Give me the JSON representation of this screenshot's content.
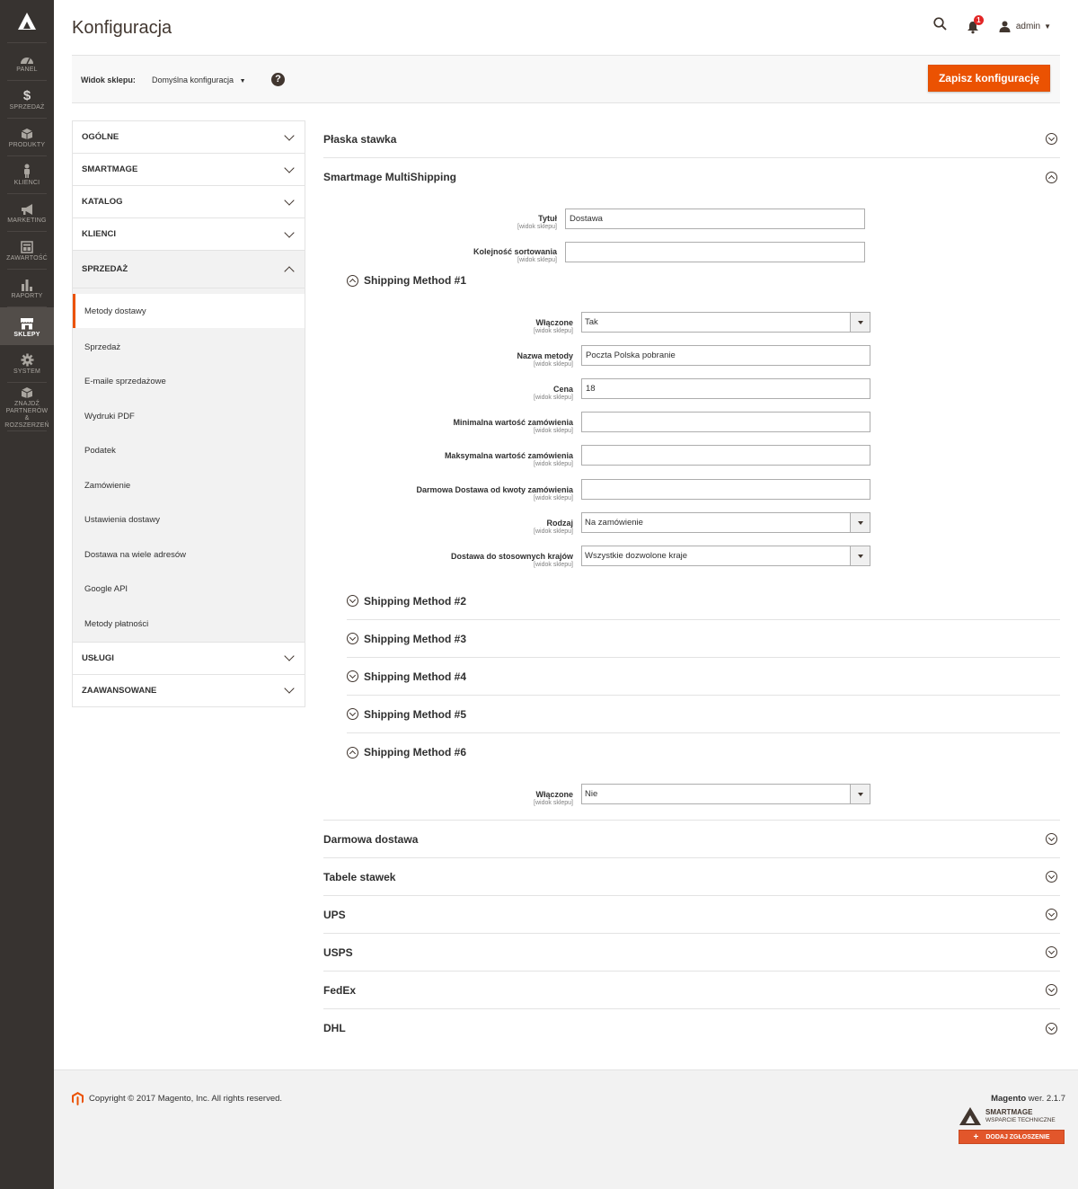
{
  "sidebar": {
    "items": [
      {
        "label": "PANEL",
        "icon": "dashboard-icon"
      },
      {
        "label": "SPRZEDAŻ",
        "icon": "dollar-icon"
      },
      {
        "label": "PRODUKTY",
        "icon": "box-icon"
      },
      {
        "label": "KLIENCI",
        "icon": "person-icon"
      },
      {
        "label": "MARKETING",
        "icon": "megaphone-icon"
      },
      {
        "label": "ZAWARTOŚĆ",
        "icon": "layout-icon"
      },
      {
        "label": "RAPORTY",
        "icon": "bar-chart-icon"
      },
      {
        "label": "SKLEPY",
        "icon": "store-icon"
      },
      {
        "label": "SYSTEM",
        "icon": "gear-icon"
      },
      {
        "label": "ZNAJDŹ PARTNERÓW & ROZSZERZEŃ",
        "icon": "extensions-icon"
      }
    ],
    "active": "SKLEPY"
  },
  "header": {
    "title": "Konfiguracja",
    "notifications_count": "1",
    "user": "admin"
  },
  "store_bar": {
    "label": "Widok sklepu:",
    "value": "Domyślna konfiguracja",
    "help": "?"
  },
  "save_button": "Zapisz konfigurację",
  "config_nav": {
    "groups_top": [
      "OGÓLNE",
      "SMARTMAGE",
      "KATALOG",
      "KLIENCI"
    ],
    "open_group": "SPRZEDAŻ",
    "sub_items": [
      "Metody dostawy",
      "Sprzedaż",
      "E-maile sprzedażowe",
      "Wydruki PDF",
      "Podatek",
      "Zamówienie",
      "Ustawienia dostawy",
      "Dostawa na wiele adresów",
      "Google API",
      "Metody płatności"
    ],
    "groups_bottom": [
      "USŁUGI",
      "ZAAWANSOWANE"
    ]
  },
  "sections": {
    "flat_rate": "Płaska stawka",
    "multishipping": "Smartmage MultiShipping",
    "free_shipping": "Darmowa dostawa",
    "table_rates": "Tabele stawek",
    "ups": "UPS",
    "usps": "USPS",
    "fedex": "FedEx",
    "dhl": "DHL"
  },
  "scope_label": "[widok sklepu]",
  "multishipping": {
    "title_label": "Tytuł",
    "title_value": "Dostawa",
    "sort_label": "Kolejność sortowania",
    "sort_value": ""
  },
  "method1": {
    "header": "Shipping Method #1",
    "enabled_label": "Włączone",
    "enabled_value": "Tak",
    "name_label": "Nazwa metody",
    "name_value": "Poczta Polska pobranie",
    "price_label": "Cena",
    "price_value": "18",
    "min_label": "Minimalna wartość zamówienia",
    "min_value": "",
    "max_label": "Maksymalna wartość zamówienia",
    "max_value": "",
    "free_label": "Darmowa Dostawa od kwoty zamówienia",
    "free_value": "",
    "type_label": "Rodzaj",
    "type_value": "Na zamówienie",
    "countries_label": "Dostawa do stosownych krajów",
    "countries_value": "Wszystkie dozwolone kraje"
  },
  "methods": {
    "m2": "Shipping Method #2",
    "m3": "Shipping Method #3",
    "m4": "Shipping Method #4",
    "m5": "Shipping Method #5",
    "m6": "Shipping Method #6"
  },
  "method6": {
    "enabled_label": "Włączone",
    "enabled_value": "Nie"
  },
  "footer": {
    "copyright": "Copyright © 2017 Magento, Inc. All rights reserved.",
    "version_brand": "Magento",
    "version_text": " wer. 2.1.7",
    "smartmage_brand": "SMARTMAGE",
    "smartmage_tagline": "WSPARCIE TECHNICZNE",
    "ticket_button": "DODAJ ZGŁOSZENIE"
  },
  "colors": {
    "accent": "#eb5202",
    "sidebar_bg": "#373330",
    "sidebar_active": "#524d49",
    "badge": "#e22626"
  }
}
